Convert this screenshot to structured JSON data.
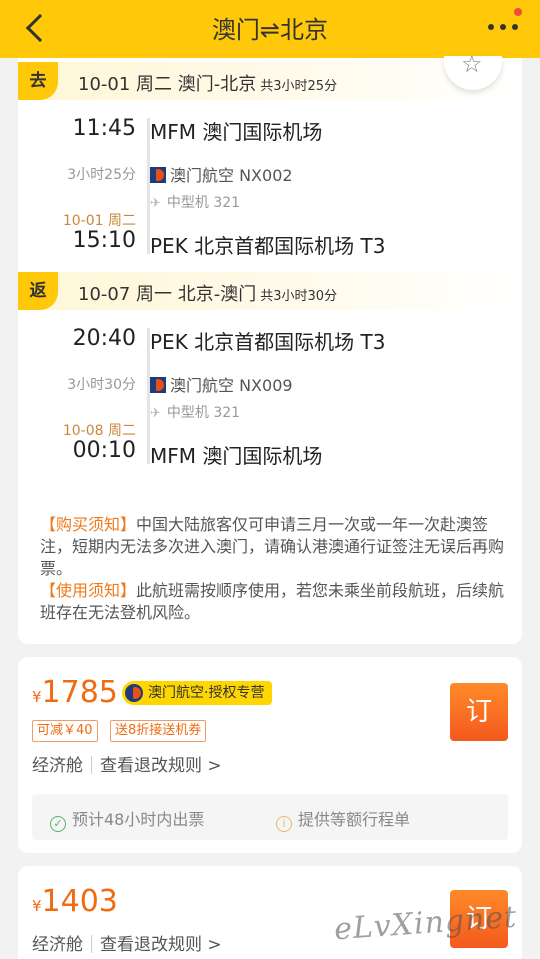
{
  "header": {
    "title": "澳门⇌北京"
  },
  "outbound": {
    "tag": "去",
    "date_route": "10-01 周二 澳门-北京",
    "total_duration": "共3小时25分",
    "dep_time": "11:45",
    "dep_airport": "MFM 澳门国际机场",
    "duration": "3小时25分",
    "airline": "澳门航空 NX002",
    "aircraft": "中型机 321",
    "arr_date": "10-01 周二",
    "arr_time": "15:10",
    "arr_airport": "PEK 北京首都国际机场 T3"
  },
  "return": {
    "tag": "返",
    "date_route": "10-07 周一 北京-澳门",
    "total_duration": "共3小时30分",
    "dep_time": "20:40",
    "dep_airport": "PEK 北京首都国际机场 T3",
    "duration": "3小时30分",
    "airline": "澳门航空 NX009",
    "aircraft": "中型机 321",
    "arr_date": "10-08 周二",
    "arr_time": "00:10",
    "arr_airport": "MFM 澳门国际机场"
  },
  "notice": {
    "purchase_label": "【购买须知】",
    "purchase_text": "中国大陆旅客仅可申请三月一次或一年一次赴澳签注，短期内无法多次进入澳门，请确认港澳通行证签注无误后再购票。",
    "usage_label": "【使用须知】",
    "usage_text": "此航班需按顺序使用，若您未乘坐前段航班，后续航班存在无法登机风险。"
  },
  "offers": [
    {
      "currency": "¥",
      "price": "1785",
      "brand_tag": "澳门航空·授权专营",
      "promo1": "可减￥40",
      "promo2": "送8折接送机券",
      "cabin": "经济舱",
      "rules": "查看退改规则 >",
      "book_label": "订",
      "service1": "预计48小时内出票",
      "service2": "提供等额行程单"
    },
    {
      "currency": "¥",
      "price": "1403",
      "cabin": "经济舱",
      "rules": "查看退改规则 >",
      "book_label": "订"
    }
  ],
  "watermark": "eLvXingnet",
  "colors": {
    "header_bg": "#ffc808",
    "price": "#f06b12",
    "notice_highlight": "#ef7a1b",
    "arrival_date": "#c9883c",
    "book_button": "#f4591d"
  }
}
